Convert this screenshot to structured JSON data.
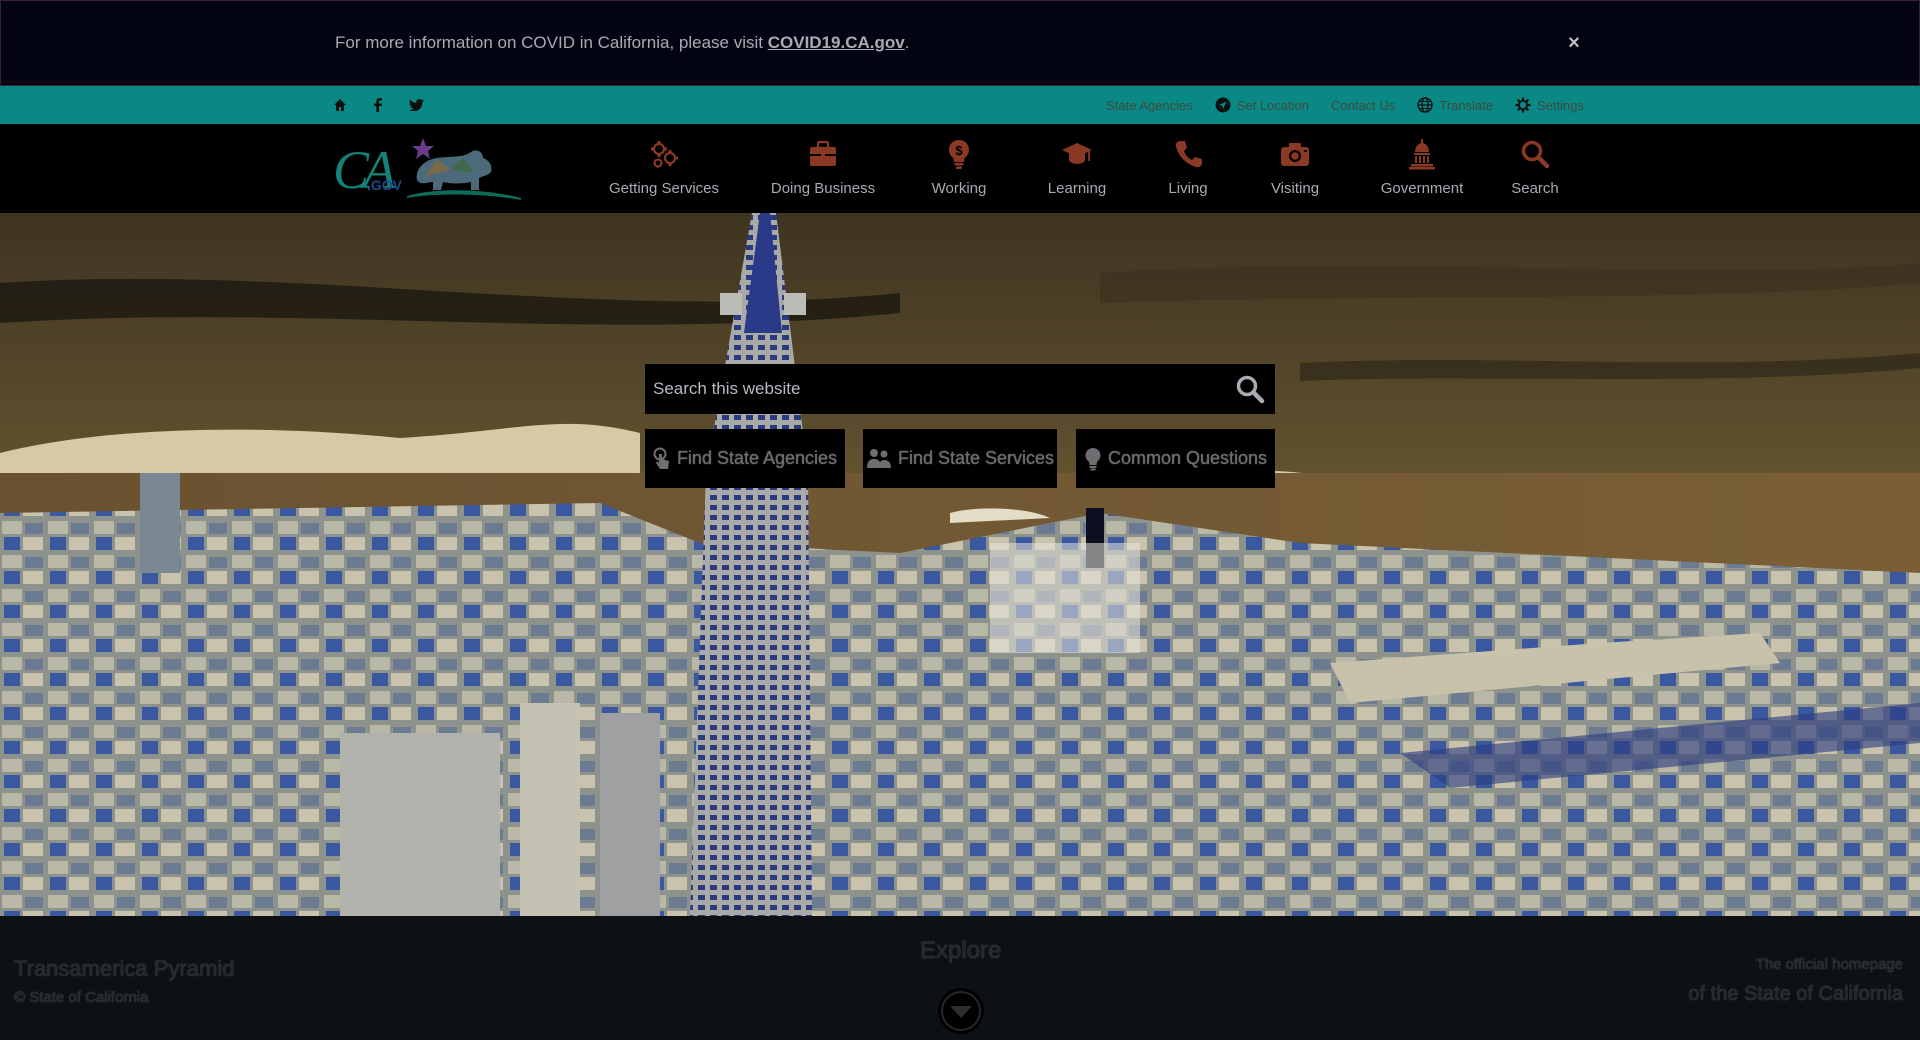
{
  "alert": {
    "text": "For more information on COVID in California, please visit ",
    "link": "COVID19.CA.gov",
    "suffix": ".",
    "close_label": "×"
  },
  "utility": {
    "left_icons": [
      "home-icon",
      "facebook-icon",
      "twitter-icon"
    ],
    "links": [
      {
        "label": "State Agencies",
        "icon": ""
      },
      {
        "label": "Set Location",
        "icon": "location-icon"
      },
      {
        "label": "Contact Us",
        "icon": ""
      },
      {
        "label": "Translate",
        "icon": "globe-icon"
      },
      {
        "label": "Settings",
        "icon": "gear-icon"
      }
    ]
  },
  "logo": {
    "text": "CA",
    "suffix": ".GOV"
  },
  "nav": {
    "items": [
      {
        "label": "Getting Services",
        "icon": "gears-icon"
      },
      {
        "label": "Doing Business",
        "icon": "briefcase-icon"
      },
      {
        "label": "Working",
        "icon": "lightbulb-dollar-icon"
      },
      {
        "label": "Learning",
        "icon": "graduation-cap-icon"
      },
      {
        "label": "Living",
        "icon": "phone-icon"
      },
      {
        "label": "Visiting",
        "icon": "camera-icon"
      },
      {
        "label": "Government",
        "icon": "capitol-icon"
      },
      {
        "label": "Search",
        "icon": "search-icon"
      }
    ]
  },
  "hero": {
    "search_placeholder": "Search this website",
    "quick_links": [
      {
        "label": "Find State Agencies",
        "icon": "touch-icon"
      },
      {
        "label": "Find State Services",
        "icon": "people-icon"
      },
      {
        "label": "Common Questions",
        "icon": "lightbulb-icon"
      }
    ]
  },
  "footer": {
    "caption_title": "Transamerica Pyramid",
    "caption_sub": "© State of California",
    "explore": "Explore",
    "official_line1": "The official homepage",
    "official_line2": "of the State of California"
  },
  "colors": {
    "utility_bar": "#0a8886",
    "nav_text": "#a9aab2",
    "nav_icon": "#8a3a24",
    "alert_bg": "#020412"
  }
}
